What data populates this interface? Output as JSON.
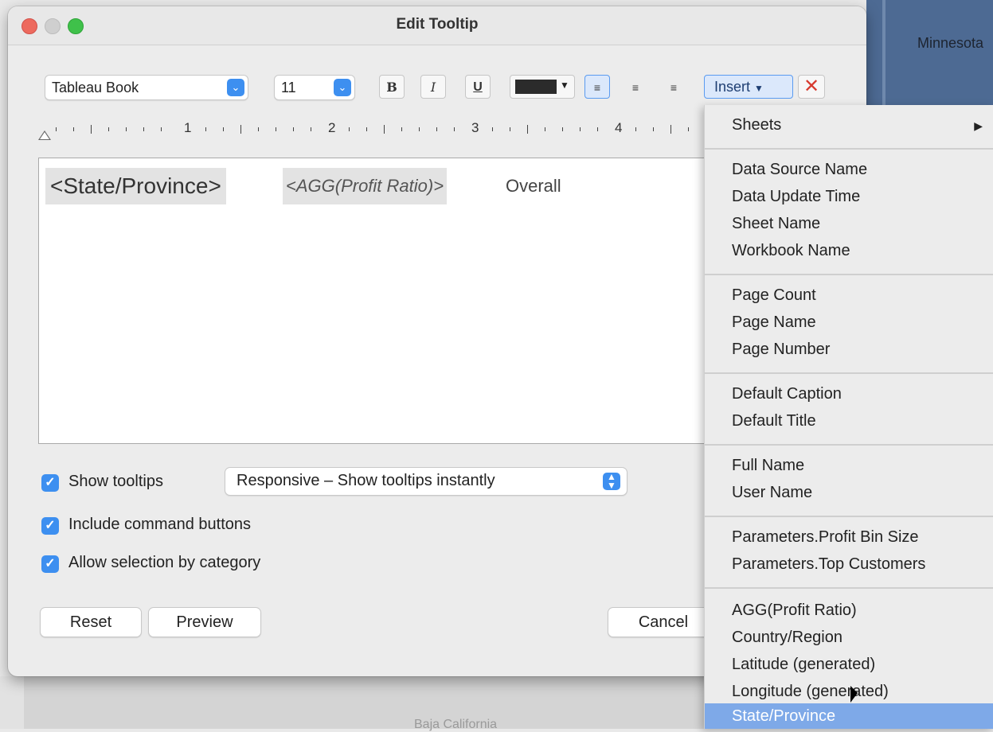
{
  "window": {
    "title": "Edit Tooltip"
  },
  "background": {
    "map_label_top": "Minnesota",
    "map_label_bottom": "Baja California"
  },
  "toolbar": {
    "font": "Tableau Book",
    "size": "11",
    "bold": "B",
    "italic": "I",
    "underline": "U",
    "text_color": "#2b2b2b",
    "insert": "Insert",
    "align": [
      "left",
      "center",
      "right"
    ]
  },
  "ruler": {
    "numbers": [
      "1",
      "2",
      "3",
      "4"
    ]
  },
  "editor": {
    "field_state": "<State/Province>",
    "field_agg": "<AGG(Profit Ratio)>",
    "text": "Overall"
  },
  "options": {
    "show_tooltips": "Show tooltips",
    "tooltip_mode": "Responsive – Show tooltips instantly",
    "include_commands": "Include command buttons",
    "allow_selection": "Allow selection by category"
  },
  "buttons": {
    "reset": "Reset",
    "preview": "Preview",
    "cancel": "Cancel"
  },
  "insert_menu": {
    "sheets": "Sheets",
    "group1": [
      "Data Source Name",
      "Data Update Time",
      "Sheet Name",
      "Workbook Name"
    ],
    "group2": [
      "Page Count",
      "Page Name",
      "Page Number"
    ],
    "group3": [
      "Default Caption",
      "Default Title"
    ],
    "group4": [
      "Full Name",
      "User Name"
    ],
    "group5": [
      "Parameters.Profit Bin Size",
      "Parameters.Top Customers"
    ],
    "group6": [
      "AGG(Profit Ratio)",
      "Country/Region",
      "Latitude (generated)",
      "Longitude (generated)",
      "State/Province"
    ],
    "highlight_color": "#7ea9e8"
  }
}
